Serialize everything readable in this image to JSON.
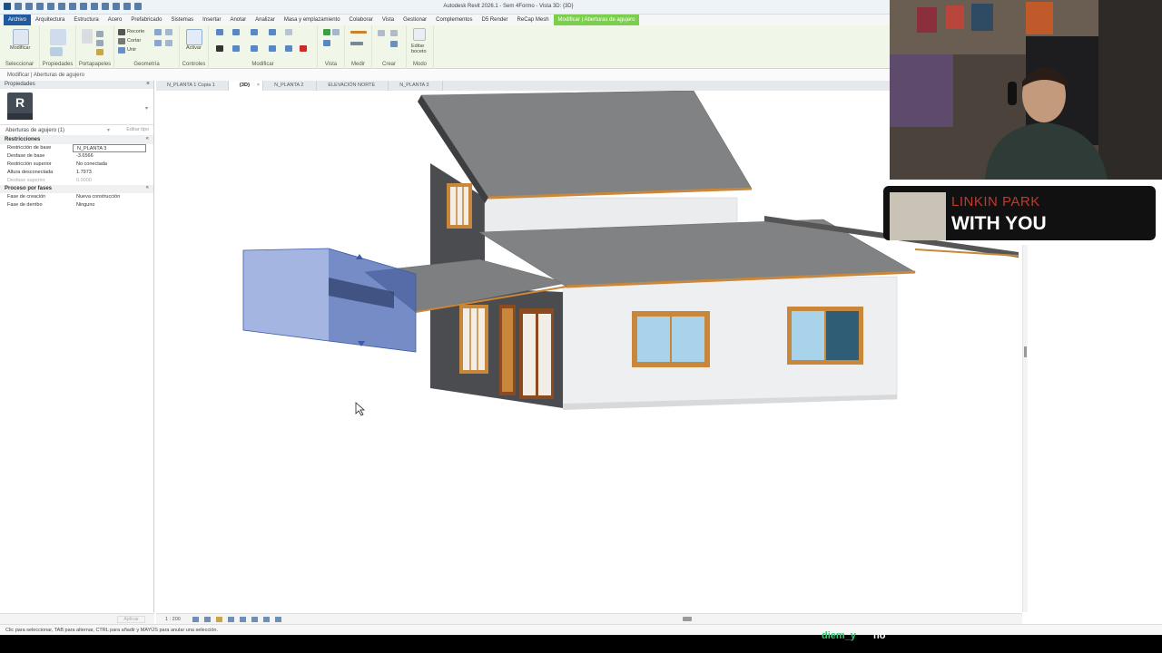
{
  "window": {
    "title": "Autodesk Revit 2026.1 - Sem 4Formo - Vista 3D: {3D}"
  },
  "menu": {
    "items": [
      "Archivo",
      "Arquitectura",
      "Estructura",
      "Acero",
      "Prefabricado",
      "Sistemas",
      "Insertar",
      "Anotar",
      "Analizar",
      "Masa y emplazamiento",
      "Colaborar",
      "Vista",
      "Gestionar",
      "Complementos",
      "D5 Render",
      "ReCap Mesh",
      "Modificar | Aberturas de agujero"
    ]
  },
  "ribbon": {
    "modify_label": "Modificar",
    "panels": [
      "Seleccionar",
      "Propiedades",
      "Portapapeles",
      "Geometría",
      "Controles",
      "Modificar",
      "Vista",
      "Medir",
      "Crear",
      "Modo"
    ],
    "small": {
      "recorte": "Recorte",
      "cortar": "Cortar",
      "unir": "Unir",
      "activar": "Activar",
      "editar_boceto": "Editar boceto"
    }
  },
  "context_line": "Modificar | Aberturas de agujero",
  "properties": {
    "header": "Propiedades",
    "logo_letter": "R",
    "selection": "Aberturas de agujero (1)",
    "edit_type": "Editar tipo",
    "groups": [
      {
        "name": "Restricciones",
        "rows": [
          {
            "key": "Restricción de base",
            "value": "N_PLANTA 3",
            "boxed": true
          },
          {
            "key": "Desfase de base",
            "value": "-3.6566"
          },
          {
            "key": "Restricción superior",
            "value": "No conectada"
          },
          {
            "key": "Altura desconectada",
            "value": "1.7973"
          },
          {
            "key": "Desfase superior",
            "value": "0.0000",
            "dim": true
          }
        ]
      },
      {
        "name": "Proceso por fases",
        "rows": [
          {
            "key": "Fase de creación",
            "value": "Nueva construcción"
          },
          {
            "key": "Fase de derribo",
            "value": "Ninguno"
          }
        ]
      }
    ],
    "apply": "Aplicar"
  },
  "tabs": [
    {
      "label": "N_PLANTA 1 Copia 1",
      "active": false
    },
    {
      "label": "{3D}",
      "active": true
    },
    {
      "label": "N_PLANTA 2",
      "active": false
    },
    {
      "label": "ELEVACIÓN NORTE",
      "active": false
    },
    {
      "label": "N_PLANTA 3",
      "active": false
    }
  ],
  "view_control": {
    "scale": "1 : 200"
  },
  "status": {
    "text": "Clic para seleccionar, TAB para alternar, CTRL para añadir y MAYÚS para anular una selección."
  },
  "overlay": {
    "artist": "LINKIN PARK",
    "song": "WITH YOU",
    "chat_user": "diem_y",
    "chat_message": "no"
  },
  "colors": {
    "ribbon_bg": "#f0f7e8",
    "context_tab": "#7ccf4a",
    "file_tab": "#1f5aa0",
    "roof": "#7d7f80",
    "fascia": "#c8873a",
    "wall": "#e9eaeb",
    "dark_wall": "#4a4c4f",
    "glass": "#a9d3ea",
    "void_blue": "#5b78c9"
  }
}
